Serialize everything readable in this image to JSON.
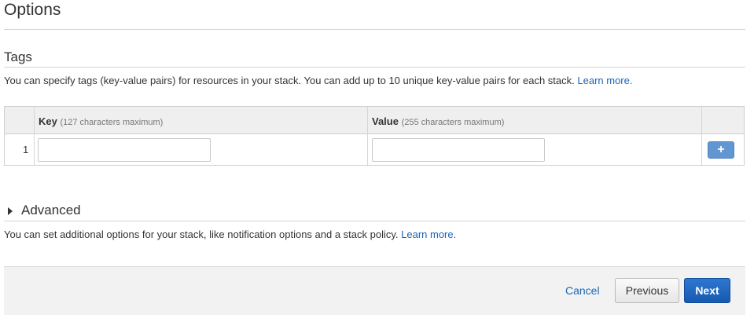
{
  "page": {
    "title": "Options"
  },
  "tags": {
    "heading": "Tags",
    "description": "You can specify tags (key-value pairs) for resources in your stack. You can add up to 10 unique key-value pairs for each stack.",
    "learn_more": "Learn more.",
    "columns": {
      "key_label": "Key",
      "key_hint": "(127 characters maximum)",
      "value_label": "Value",
      "value_hint": "(255 characters maximum)"
    },
    "rows": [
      {
        "index": "1",
        "key": "",
        "value": ""
      }
    ],
    "add_button_label": "+"
  },
  "advanced": {
    "heading": "Advanced",
    "description": "You can set additional options for your stack, like notification options and a stack policy.",
    "learn_more": "Learn more."
  },
  "footer": {
    "cancel_label": "Cancel",
    "previous_label": "Previous",
    "next_label": "Next"
  },
  "colors": {
    "link": "#1a66b5",
    "primary_button": "#1f66be",
    "add_button": "#6296d0"
  }
}
